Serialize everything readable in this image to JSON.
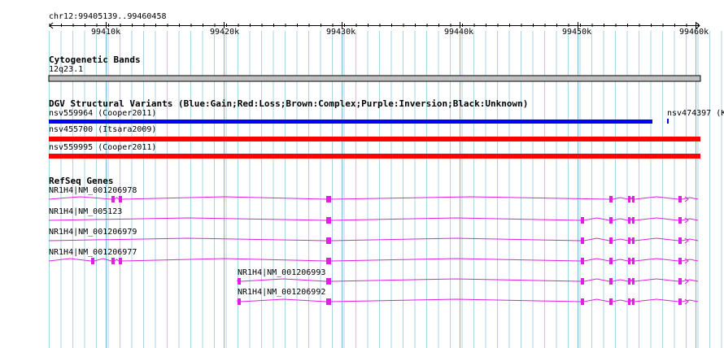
{
  "ruler": {
    "location": "chr12:99405139..99460458",
    "ticks": [
      "99410k",
      "99420k",
      "99430k",
      "99440k",
      "99450k",
      "99460k"
    ]
  },
  "colors": {
    "grid": "#a9d6e5",
    "gene": "#e020e0",
    "gain": "#0000ff",
    "loss": "#ff0000",
    "band": "#bfbfbf"
  },
  "tracks": {
    "cytoband": {
      "title": "Cytogenetic Bands",
      "band_label": "12q23.1"
    },
    "dgv": {
      "title": "DGV Structural Variants (Blue:Gain;Red:Loss;Brown:Complex;Purple:Inversion;Black:Unknown)",
      "features": [
        {
          "label": "nsv559964 (Cooper2011)",
          "type": "gain"
        },
        {
          "label": "nsv474397 (K",
          "type": "gain"
        },
        {
          "label": "nsv455700 (Itsara2009)",
          "type": "loss"
        },
        {
          "label": "nsv559995 (Cooper2011)",
          "type": "loss"
        }
      ]
    },
    "refseq": {
      "title": "RefSeq Genes",
      "transcripts": [
        {
          "label": "NR1H4|NM_001206978"
        },
        {
          "label": "NR1H4|NM_005123"
        },
        {
          "label": "NR1H4|NM_001206979"
        },
        {
          "label": "NR1H4|NM_001206977"
        },
        {
          "label": "NR1H4|NM_001206993"
        },
        {
          "label": "NR1H4|NM_001206992"
        }
      ]
    }
  }
}
